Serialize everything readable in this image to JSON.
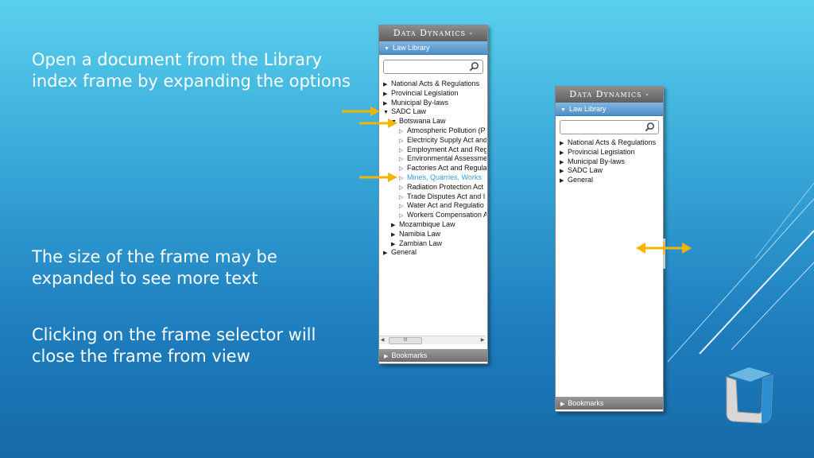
{
  "captions": {
    "c1_line1": "Open a document from the Library",
    "c1_line2": "index frame by expanding the options",
    "c2_line1": "The size of the frame may be",
    "c2_line2": "expanded to see more text",
    "c3_line1": "Clicking on the frame selector will",
    "c3_line2": "close the frame from view"
  },
  "frame_left": {
    "brand": "Data Dynamics -",
    "header": "Law Library",
    "search_placeholder": "",
    "tree": [
      {
        "label": "National Acts & Regulations",
        "arrow": "collapsed",
        "level": 0
      },
      {
        "label": "Provincial Legislation",
        "arrow": "collapsed",
        "level": 0
      },
      {
        "label": "Municipal By-laws",
        "arrow": "collapsed",
        "level": 0
      },
      {
        "label": "SADC Law",
        "arrow": "expanded",
        "level": 0
      },
      {
        "label": "Botswana Law",
        "arrow": "expanded",
        "level": 1
      },
      {
        "label": "Atmospheric Pollution (P",
        "arrow": "leaf",
        "level": 2
      },
      {
        "label": "Electricity Supply Act and",
        "arrow": "leaf",
        "level": 2
      },
      {
        "label": "Employment Act and Reg",
        "arrow": "leaf",
        "level": 2
      },
      {
        "label": "Environmental Assessme",
        "arrow": "leaf",
        "level": 2
      },
      {
        "label": "Factories Act and Regula",
        "arrow": "leaf",
        "level": 2
      },
      {
        "label": "Mines, Quarries, Works",
        "arrow": "leaf",
        "level": 2,
        "selected": true
      },
      {
        "label": "Radiation Protection Act",
        "arrow": "leaf",
        "level": 2
      },
      {
        "label": "Trade Disputes Act and I",
        "arrow": "leaf",
        "level": 2
      },
      {
        "label": "Water Act and Regulatio",
        "arrow": "leaf",
        "level": 2
      },
      {
        "label": "Workers Compensation A",
        "arrow": "leaf",
        "level": 2
      },
      {
        "label": "Mozambique Law",
        "arrow": "collapsed",
        "level": 1
      },
      {
        "label": "Namibia Law",
        "arrow": "collapsed",
        "level": 1
      },
      {
        "label": "Zambian Law",
        "arrow": "collapsed",
        "level": 1
      },
      {
        "label": "General",
        "arrow": "collapsed",
        "level": 0
      }
    ],
    "scroll_thumb": "III",
    "footer": "Bookmarks"
  },
  "frame_right": {
    "brand": "Data Dynamics -",
    "header": "Law Library",
    "search_placeholder": "",
    "tree": [
      {
        "label": "National Acts & Regulations",
        "arrow": "collapsed",
        "level": 0
      },
      {
        "label": "Provincial Legislation",
        "arrow": "collapsed",
        "level": 0
      },
      {
        "label": "Municipal By-laws",
        "arrow": "collapsed",
        "level": 0
      },
      {
        "label": "SADC Law",
        "arrow": "collapsed",
        "level": 0
      },
      {
        "label": "General",
        "arrow": "collapsed",
        "level": 0
      }
    ],
    "footer": "Bookmarks"
  },
  "icons": {
    "search": "magnifier-icon",
    "collapsed": "triangle-right-icon",
    "expanded": "triangle-down-icon",
    "leaf": "hollow-triangle-right-icon"
  },
  "colors": {
    "highlight_arrow": "#f5b400",
    "selected_item": "#3a9ad8",
    "header_blue": "#5a9ad0"
  }
}
